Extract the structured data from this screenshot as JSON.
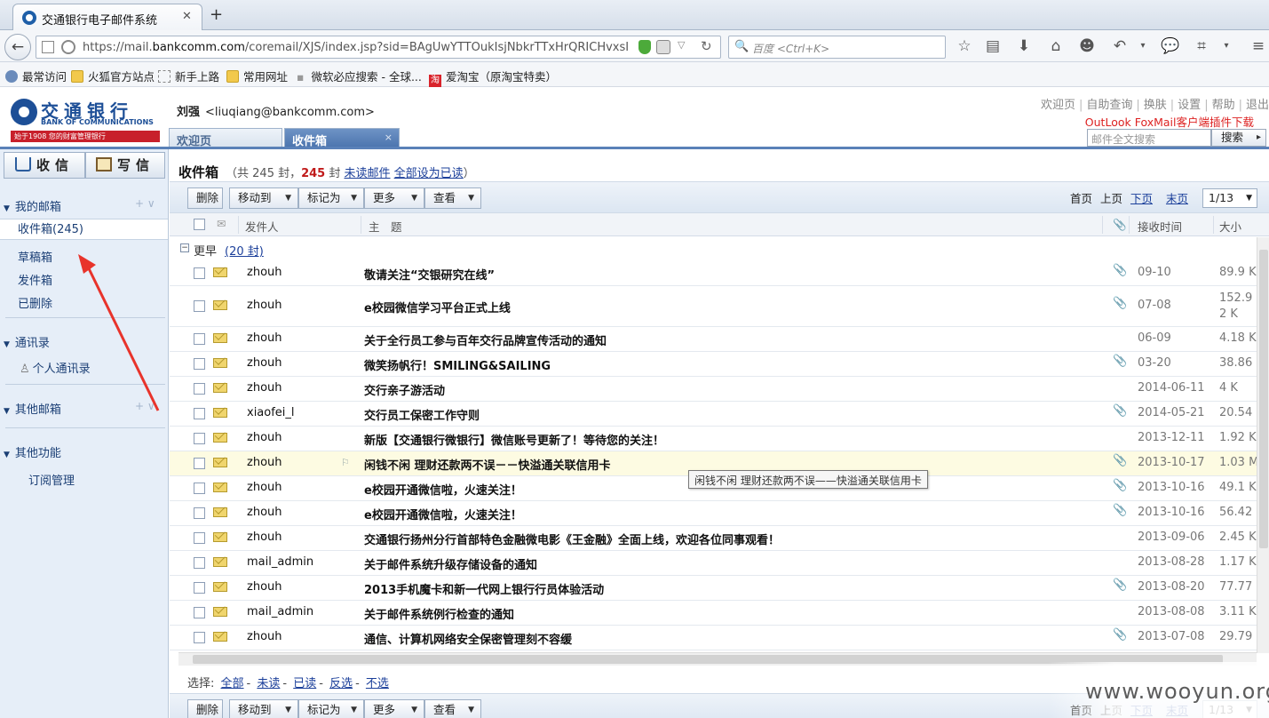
{
  "browser": {
    "tab_title": "交通银行电子邮件系统",
    "tab_close": "✕",
    "new_tab": "+",
    "url_prefix": "https://mail.",
    "url_domain": "bankcomm.com",
    "url_rest": "/coremail/XJS/index.jsp?sid=BAgUwYTTOukIsjNbkrTTxHrQRICHvxsI",
    "search_placeholder": "百度 <Ctrl+K>",
    "bookmarks": [
      "最常访问",
      "火狐官方站点",
      "新手上路",
      "常用网址",
      "微软必应搜索 - 全球...",
      "爱淘宝（原淘宝特卖）"
    ]
  },
  "header": {
    "logo_cn": "交通银行",
    "logo_en": "BANK OF COMMUNICATIONS",
    "logo_slogan": "始于1908 您的财富管理银行",
    "user_name": "刘强",
    "user_email": "<liuqiang@bankcomm.com>",
    "links": [
      "欢迎页",
      "自助查询",
      "换肤",
      "设置",
      "帮助",
      "退出"
    ],
    "plugin_link": "OutLook FoxMail客户端插件下载",
    "fulltext_placeholder": "邮件全文搜索",
    "search_button": "搜索",
    "tabs": [
      {
        "label": "欢迎页"
      },
      {
        "label": "收件箱",
        "close": "×"
      }
    ]
  },
  "sidebar": {
    "receive": "收信",
    "compose": "写信",
    "my_mailbox": "我的邮箱",
    "folders": [
      "收件箱(245)",
      "草稿箱",
      "发件箱",
      "已删除"
    ],
    "contacts": "通讯录",
    "personal_contacts": "个人通讯录",
    "other_mailbox": "其他邮箱",
    "other_functions": "其他功能",
    "subscription": "订阅管理",
    "section_actions": "+ ∨"
  },
  "main": {
    "title": "收件箱",
    "count_prefix": "（共 245 封，",
    "unread_count": "245",
    "count_mid": " 封 ",
    "unread_link": "未读邮件",
    "mark_all_read": "全部设为已读",
    "count_suffix": "）",
    "toolbar": {
      "delete": "删除",
      "move": "移动到",
      "mark": "标记为",
      "more": "更多",
      "view": "查看"
    },
    "pager": {
      "first": "首页",
      "prev": "上页",
      "next": "下页",
      "last": "末页",
      "page": "1/13"
    },
    "columns": {
      "from": "发件人",
      "subject": "主　题",
      "date": "接收时间",
      "size": "大小"
    },
    "group": {
      "label": "更早",
      "count": "(20 封)"
    },
    "tooltip": "闲钱不闲  理财还款两不误——快溢通关联信用卡",
    "select": {
      "label": "选择:",
      "all": "全部",
      "unread": "未读",
      "read": "已读",
      "invert": "反选",
      "none": "不选"
    }
  },
  "emails": [
    {
      "from": "zhouh",
      "subject": "敬请关注“交银研究在线”",
      "attach": true,
      "date": "09-10",
      "size": "89.9 K"
    },
    {
      "from": "zhouh",
      "subject": "e校园微信学习平台正式上线",
      "attach": true,
      "date": "07-08",
      "size": "152.92 K"
    },
    {
      "from": "zhouh",
      "subject": "关于全行员工参与百年交行品牌宣传活动的通知",
      "attach": false,
      "date": "06-09",
      "size": "4.18 K"
    },
    {
      "from": "zhouh",
      "subject": "微笑扬帆行！SMILING&SAILING",
      "attach": true,
      "date": "03-20",
      "size": "38.86"
    },
    {
      "from": "zhouh",
      "subject": "交行亲子游活动",
      "attach": false,
      "date": "2014-06-11",
      "size": "4 K"
    },
    {
      "from": "xiaofei_l",
      "subject": "交行员工保密工作守则",
      "attach": true,
      "date": "2014-05-21",
      "size": "20.54"
    },
    {
      "from": "zhouh",
      "subject": "新版【交通银行微银行】微信账号更新了！等待您的关注！",
      "attach": false,
      "date": "2013-12-11",
      "size": "1.92 K"
    },
    {
      "from": "zhouh",
      "subject": "闲钱不闲  理财还款两不误－－快溢通关联信用卡",
      "attach": true,
      "date": "2013-10-17",
      "size": "1.03 M"
    },
    {
      "from": "zhouh",
      "subject": "e校园开通微信啦，火速关注！",
      "attach": true,
      "date": "2013-10-16",
      "size": "49.1 K"
    },
    {
      "from": "zhouh",
      "subject": "e校园开通微信啦，火速关注！",
      "attach": true,
      "date": "2013-10-16",
      "size": "56.42"
    },
    {
      "from": "zhouh",
      "subject": "交通银行扬州分行首部特色金融微电影《王金融》全面上线，欢迎各位同事观看！",
      "attach": false,
      "date": "2013-09-06",
      "size": "2.45 K"
    },
    {
      "from": "mail_admin",
      "subject": "关于邮件系统升级存储设备的通知",
      "attach": false,
      "date": "2013-08-28",
      "size": "1.17 K"
    },
    {
      "from": "zhouh",
      "subject": "2013手机魔卡和新一代网上银行行员体验活动",
      "attach": true,
      "date": "2013-08-20",
      "size": "77.77"
    },
    {
      "from": "mail_admin",
      "subject": "关于邮件系统例行检查的通知",
      "attach": false,
      "date": "2013-08-08",
      "size": "3.11 K"
    },
    {
      "from": "zhouh",
      "subject": "通信、计算机网络安全保密管理刻不容缓",
      "attach": true,
      "date": "2013-07-08",
      "size": "29.79"
    }
  ],
  "watermark": "www.wooyun.org",
  "colors": {
    "accent": "#4a73ad",
    "link": "#1b3f9a",
    "unread": "#c01a1a",
    "sidebar_bg": "#e6eef8",
    "highlight_row": "#fdfbe2"
  }
}
